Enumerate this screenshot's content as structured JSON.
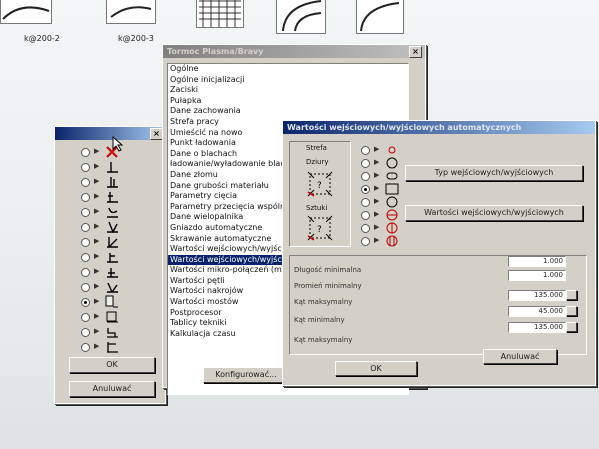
{
  "desktop": {
    "thumbnails": [
      {
        "label": "k@200-2"
      },
      {
        "label": "k@200-3"
      },
      {
        "label": ""
      },
      {
        "label": ""
      },
      {
        "label": ""
      }
    ]
  },
  "left_dialog": {
    "close_glyph": "×",
    "options": [
      {
        "checked": false
      },
      {
        "checked": false
      },
      {
        "checked": false
      },
      {
        "checked": false
      },
      {
        "checked": false
      },
      {
        "checked": false
      },
      {
        "checked": false
      },
      {
        "checked": false
      },
      {
        "checked": false
      },
      {
        "checked": false
      },
      {
        "checked": true
      },
      {
        "checked": false
      },
      {
        "checked": false
      },
      {
        "checked": false
      }
    ],
    "ok_label": "OK",
    "cancel_label": "Anuluwać"
  },
  "main_dialog": {
    "title": "Tormoc Plasma/Bravy",
    "close_glyph": "×",
    "items": [
      "Ogólne",
      "Ogólne inicjalizacji",
      "Zaciski",
      "Pułapka",
      "Dane zachowania",
      "Strefa pracy",
      "Umieścić na nowo",
      "Punkt ładowania",
      "Dane o blachach",
      "ładowanie/wyładowanie blach",
      "Dane złomu",
      "Dane grubości materiału",
      "Parametry cięcia",
      "Parametry przecięcia wspólnego",
      "Dane wielopalnika",
      "Gniazdo automatyczne",
      "Skrawanie automatyczne",
      "Wartości wejściowych/wyjściow",
      "Wartości wejściowych/wyjściow",
      "Wartości mikro-połączeń (micro",
      "Wartości pętli",
      "Wartości nakrojów",
      "Wartości mostów",
      "Postprocesor",
      "Tablicy tekniki",
      "Kalkulacja czasu"
    ],
    "selected_index": 18,
    "configure_label": "Konfigurować..."
  },
  "io_dialog": {
    "title": "Wartości wejściowych/wyjściowych automatycznych",
    "zone_label": "Strefa",
    "large_label": "Dziury",
    "small_label": "Sztuki",
    "shape_radios": [
      {
        "checked": false
      },
      {
        "checked": false
      },
      {
        "checked": false
      },
      {
        "checked": true
      },
      {
        "checked": false
      },
      {
        "checked": false
      },
      {
        "checked": false
      },
      {
        "checked": false
      }
    ],
    "type_button_label": "Typ wejściowych/wyjściowych",
    "values_button_label": "Wartości wejściowych/wyjściowych",
    "fields": [
      {
        "label": "Długość minimalna",
        "value": "1.000"
      },
      {
        "label": "Promień minimalny",
        "value": "1.000"
      },
      {
        "label": "Kąt maksymalny",
        "value": "135.000"
      },
      {
        "label": "Kąt minimalny",
        "value": "45.000"
      },
      {
        "label": "Kąt maksymalny",
        "value": "135.000"
      }
    ],
    "ok_label": "OK",
    "cancel_label": "Anuluwać"
  }
}
